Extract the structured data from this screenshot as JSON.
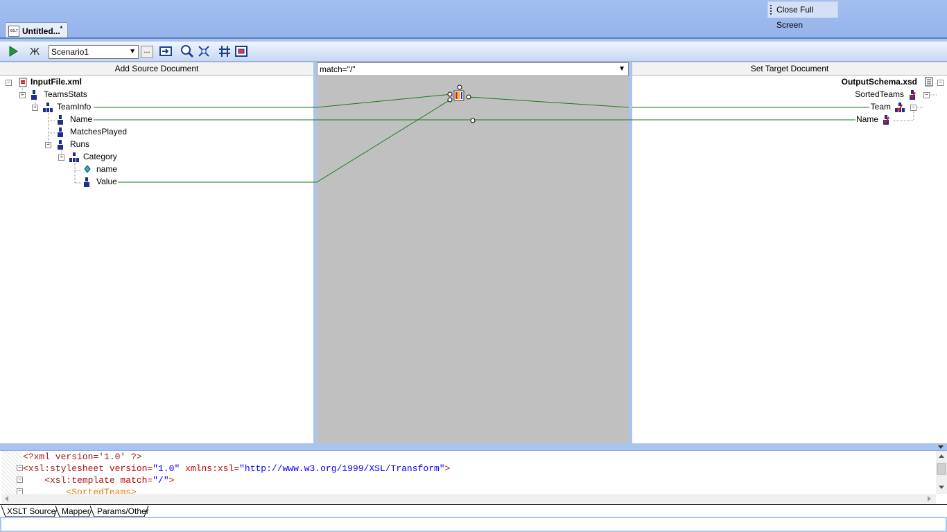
{
  "window": {
    "close_full_screen": "Close Full Screen",
    "doc_tab": "Untitled...",
    "doc_tab_modified": "*",
    "doc_icon_text": "XSLT"
  },
  "toolbar": {
    "scenario_value": "Scenario1",
    "ellipsis": "..."
  },
  "source": {
    "header": "Add Source Document",
    "nodes": [
      "InputFile.xml",
      "TeamsStats",
      "TeamInfo",
      "Name",
      "MatchesPlayed",
      "Runs",
      "Category",
      "name",
      "Value"
    ]
  },
  "middle": {
    "match": "match=\"/\""
  },
  "target": {
    "header": "Set Target Document",
    "nodes": [
      "OutputSchema.xsd",
      "SortedTeams",
      "Team",
      "Name"
    ]
  },
  "code": {
    "l1": "<?xml version='1.0' ?>",
    "l2_tag": "<xsl:stylesheet",
    "l2_attr1": " version=",
    "l2_val1": "\"1.0\"",
    "l2_attr2": " xmlns:xsl=",
    "l2_val2": "\"http://www.w3.org/1999/XSL/Transform\"",
    "l2_end": ">",
    "l3_tag": "    <xsl:template",
    "l3_attr": " match=",
    "l3_val": "\"/\"",
    "l3_end": ">",
    "l4": "        <SortedTeams>"
  },
  "bottom_tabs": [
    "XSLT Source",
    "Mapper",
    "Params/Other"
  ],
  "colors": {
    "link_line": "#1a7a1a",
    "canvas": "#c0c0c0",
    "frame": "#a9c4ee"
  }
}
